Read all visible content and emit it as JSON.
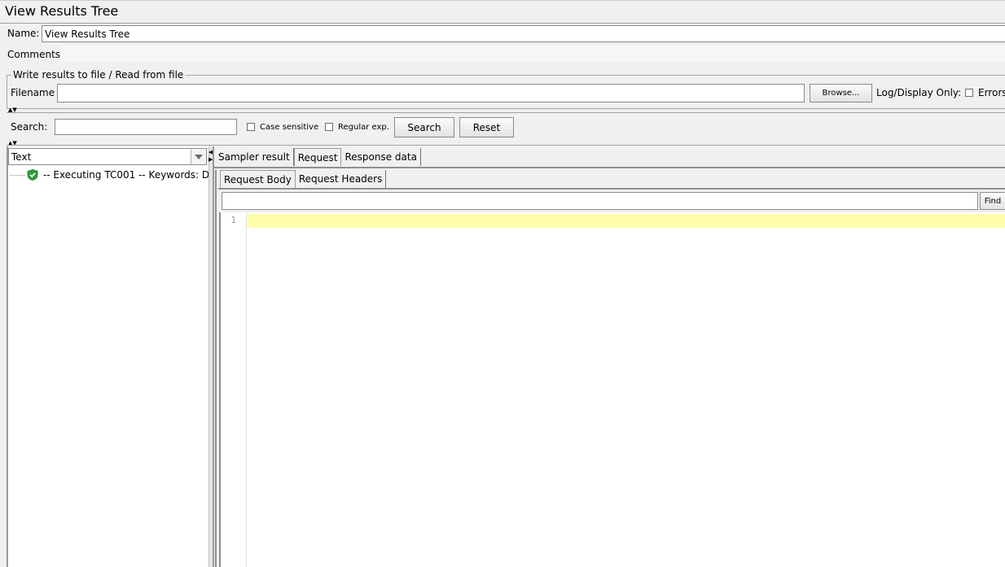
{
  "window": {
    "title": "View Results Tree"
  },
  "name_row": {
    "label": "Name:",
    "value": "View Results Tree"
  },
  "comments_row": {
    "label": "Comments:"
  },
  "file_group": {
    "legend": "Write results to file / Read from file",
    "filename_label": "Filename",
    "filename_value": "",
    "browse_label": "Browse...",
    "log_label": "Log/Display Only:",
    "errors_label": "Errors"
  },
  "search_bar": {
    "label": "Search:",
    "value": "",
    "case_label": "Case sensitive",
    "regex_label": "Regular exp.",
    "search_button": "Search",
    "reset_button": "Reset"
  },
  "left_panel": {
    "renderer_selected": "Text",
    "tree_items": [
      {
        "label": "-- Executing TC001  -- Keywords: D",
        "status": "success"
      }
    ]
  },
  "right_panel": {
    "tabs": [
      "Sampler result",
      "Request",
      "Response data"
    ],
    "selected_tab": "Request",
    "sub_tabs": [
      "Request Body",
      "Request Headers"
    ],
    "selected_sub_tab": "Request Body",
    "find_value": "",
    "find_button": "Find",
    "editor": {
      "line_numbers": [
        "1"
      ],
      "highlight_color": "#ffffaa"
    }
  },
  "colors": {
    "success": "#2e9e3a"
  }
}
